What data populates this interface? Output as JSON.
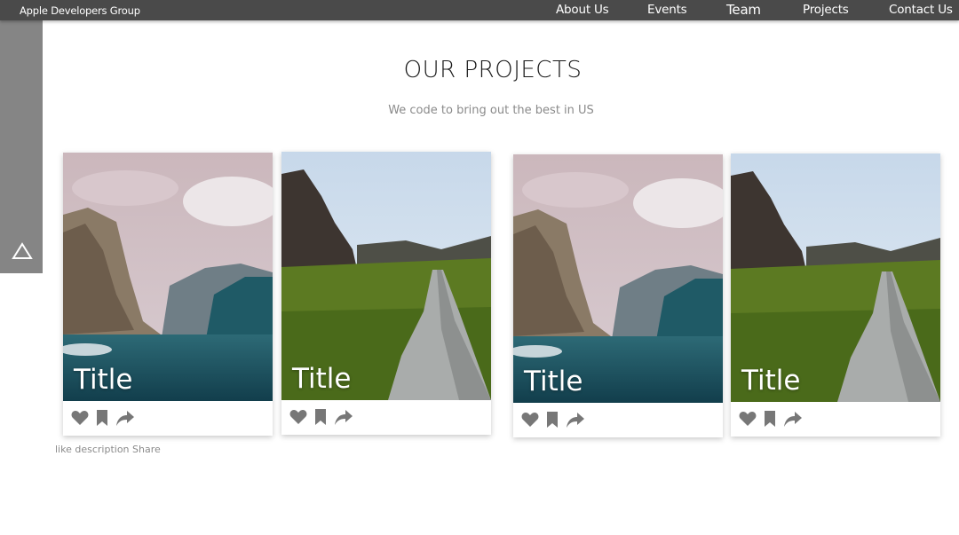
{
  "header": {
    "brand": "Apple Developers Group",
    "nav": [
      {
        "label": "About Us"
      },
      {
        "label": "Events"
      },
      {
        "label": "Team"
      },
      {
        "label": "Projects"
      },
      {
        "label": "Contact Us"
      }
    ]
  },
  "side_tab": {
    "icon": "triangle-icon"
  },
  "main": {
    "title": "OUR PROJECTS",
    "subtitle": "We code to bring out the best in US"
  },
  "cards": [
    {
      "title": "Title",
      "image": "mountain-valley",
      "actions": [
        "heart-icon",
        "bookmark-icon",
        "share-icon"
      ]
    },
    {
      "title": "Title",
      "image": "wooden-path",
      "actions": [
        "heart-icon",
        "bookmark-icon",
        "share-icon"
      ]
    },
    {
      "title": "Title",
      "image": "mountain-valley",
      "actions": [
        "heart-icon",
        "bookmark-icon",
        "share-icon"
      ]
    },
    {
      "title": "Title",
      "image": "wooden-path",
      "actions": [
        "heart-icon",
        "bookmark-icon",
        "share-icon"
      ]
    }
  ],
  "footnote": "like description Share",
  "colors": {
    "topbar": "#4a4a4a",
    "side_tab": "#858585",
    "icon_gray": "#777777",
    "subtitle_gray": "#8a8a8a"
  }
}
